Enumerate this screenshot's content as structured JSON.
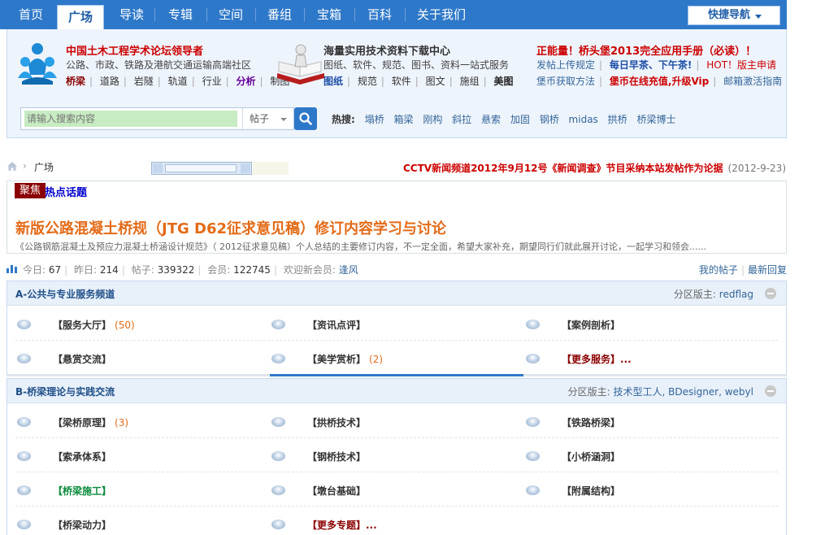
{
  "nav": {
    "items": [
      "首页",
      "广场",
      "导读",
      "专辑",
      "空间",
      "番组",
      "宝箱",
      "百科",
      "关于我们"
    ],
    "active_index": 1,
    "quick_nav": "快捷导航"
  },
  "promo": {
    "left": {
      "title": "中国土木工程学术论坛领导者",
      "subtitle": "公路、市政、铁路及港航交通运输高端社区",
      "links": [
        "桥梁",
        "道路",
        "岩隧",
        "轨道",
        "行业",
        "分析",
        "制图"
      ]
    },
    "middle": {
      "title": "海量实用技术资料下载中心",
      "subtitle": "图纸、软件、规范、图书、资料一站式服务",
      "links": [
        "图纸",
        "规范",
        "软件",
        "图文",
        "施组",
        "美图"
      ]
    },
    "right": {
      "title": "正能量！桥头堡2013完全应用手册（必读）！",
      "line2": [
        "发帖上传规定",
        "每日早茶、下午茶!",
        "HOT！版主申请"
      ],
      "line3": [
        "堡币获取方法",
        "堡币在线充值,升级Vip",
        "邮箱激活指南"
      ]
    }
  },
  "search": {
    "placeholder": "请输入搜索内容",
    "scope": "帖子",
    "hot_label": "热搜:",
    "hot_terms": [
      "塌桥",
      "箱梁",
      "刚构",
      "斜拉",
      "悬索",
      "加固",
      "钢桥",
      "midas",
      "拱桥",
      "桥梁博士"
    ]
  },
  "breadcrumb": {
    "current": "广场"
  },
  "notice": {
    "text": "CCTV新闻频道2012年9月12号《新闻调查》节目采纳本站发帖作为论据",
    "date": "(2012-9-23)"
  },
  "focus": {
    "badge": "聚焦",
    "label": "热点话题",
    "headline": "新版公路混凝土桥规（JTG D62征求意见稿）修订内容学习与讨论",
    "summary": "《公路钢筋混凝土及预应力混凝土桥涵设计规范》（ 2012征求意见稿）个人总结的主要修订内容，不一定全面，希望大家补充，期望同行们就此展开讨论，一起学习和领会......"
  },
  "stats": {
    "today_label": "今日:",
    "today": "67",
    "yesterday_label": "昨日:",
    "yesterday": "214",
    "posts_label": "帖子:",
    "posts": "339322",
    "members_label": "会员:",
    "members": "122745",
    "welcome_label": "欢迎新会员:",
    "new_member": "逢风",
    "my_posts": "我的帖子",
    "latest_replies": "最新回复"
  },
  "sections": [
    {
      "title": "A-公共与专业服务频道",
      "mods_label": "分区版主:",
      "mods": "redflag",
      "forums": [
        {
          "name": "【服务大厅】",
          "count": "(50)",
          "color": "#333333"
        },
        {
          "name": "【资讯点评】",
          "count": "",
          "color": "#333333"
        },
        {
          "name": "【案例剖析】",
          "count": "",
          "color": "#333333"
        },
        {
          "name": "【悬赏交流】",
          "count": "",
          "color": "#333333"
        },
        {
          "name": "【美学赏析】",
          "count": "(2)",
          "color": "#333333"
        },
        {
          "name": "【更多服务】...",
          "count": "",
          "color": "#8b0000"
        }
      ]
    },
    {
      "title": "B-桥梁理论与实践交流",
      "mods_label": "分区版主:",
      "mods": "技术型工人, BDesigner, webyl",
      "forums": [
        {
          "name": "【梁桥原理】",
          "count": "(3)",
          "color": "#333333"
        },
        {
          "name": "【拱桥技术】",
          "count": "",
          "color": "#333333"
        },
        {
          "name": "【铁路桥梁】",
          "count": "",
          "color": "#333333"
        },
        {
          "name": "【索承体系】",
          "count": "",
          "color": "#333333"
        },
        {
          "name": "【钢桥技术】",
          "count": "",
          "color": "#333333"
        },
        {
          "name": "【小桥涵洞】",
          "count": "",
          "color": "#333333"
        },
        {
          "name": "【桥梁施工】",
          "count": "",
          "color": "#0a8a3a"
        },
        {
          "name": "【墩台基础】",
          "count": "",
          "color": "#333333"
        },
        {
          "name": "【附属结构】",
          "count": "",
          "color": "#333333"
        },
        {
          "name": "【桥梁动力】",
          "count": "",
          "color": "#333333"
        },
        {
          "name": "【更多专题】...",
          "count": "",
          "color": "#8b0000"
        }
      ]
    }
  ],
  "colors": {
    "nav_bg": "#2e78c9",
    "accent_red": "#cc0000",
    "accent_orange": "#e46b18",
    "link_blue": "#336699"
  }
}
